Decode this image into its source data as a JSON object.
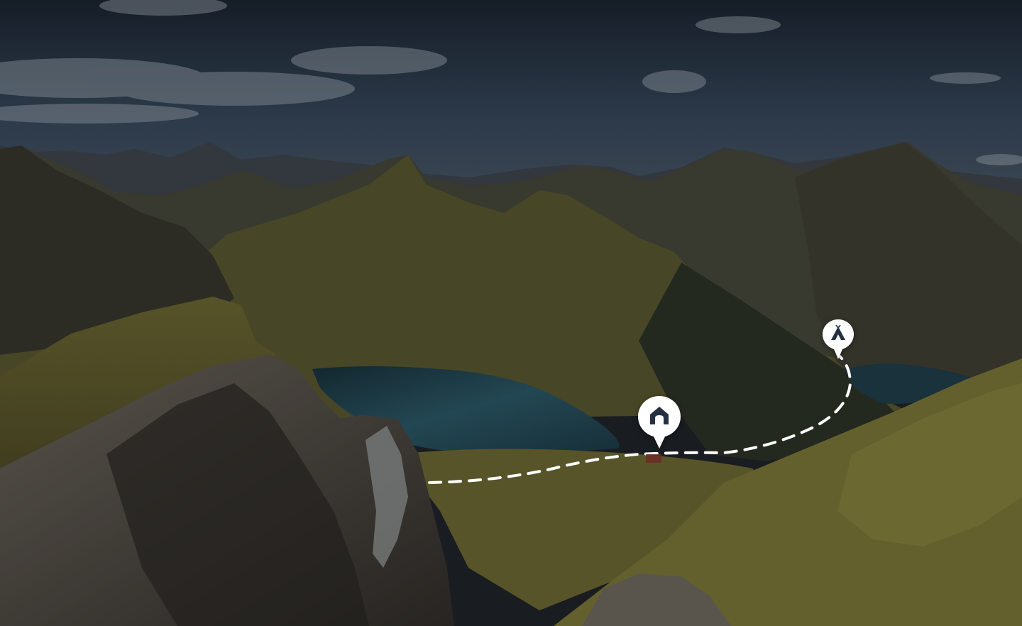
{
  "scene": {
    "description_label": "",
    "colors": {
      "sky_top": "#1e2a37",
      "sky_mid": "#3a4a5a",
      "cloud": "#aab4bf",
      "mountain_far": "#3c4047",
      "mountain_mid": "#4a4a3d",
      "grass": "#6e6a35",
      "grass_light": "#8a8541",
      "rock": "#5a544c",
      "lake": "#1f3f4a",
      "lake_light": "#2b5766",
      "trail": "#ffffff",
      "pin": "#ffffff",
      "pin_icon": "#253040"
    }
  },
  "markers": [
    {
      "name": "hut-marker",
      "icon": "house-icon"
    },
    {
      "name": "camp-marker",
      "icon": "tent-icon"
    }
  ],
  "trail": {
    "style": "dashed"
  }
}
